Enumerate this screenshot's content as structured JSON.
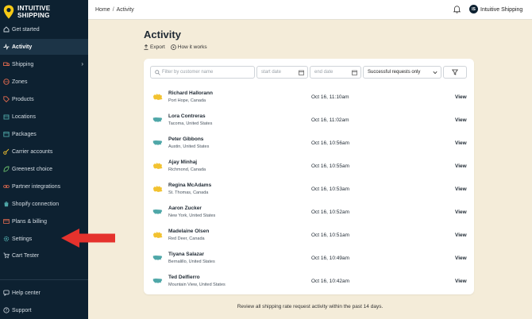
{
  "brand": {
    "line1": "INTUITIVE",
    "line2": "SHIPPING",
    "accent": "#f6c915"
  },
  "sidebar": {
    "items": [
      {
        "label": "Get started",
        "icon": "home-icon"
      },
      {
        "label": "Activity",
        "icon": "activity-icon",
        "active": true
      },
      {
        "label": "Shipping",
        "icon": "truck-icon",
        "expandable": true
      },
      {
        "label": "Zones",
        "icon": "globe-icon"
      },
      {
        "label": "Products",
        "icon": "tag-icon"
      },
      {
        "label": "Locations",
        "icon": "pin-icon"
      },
      {
        "label": "Packages",
        "icon": "package-icon"
      },
      {
        "label": "Carrier accounts",
        "icon": "key-icon"
      },
      {
        "label": "Greenest choice",
        "icon": "leaf-icon"
      },
      {
        "label": "Partner integrations",
        "icon": "link-icon"
      },
      {
        "label": "Shopify connection",
        "icon": "shopify-icon"
      },
      {
        "label": "Plans & billing",
        "icon": "card-icon"
      },
      {
        "label": "Settings",
        "icon": "gear-icon"
      },
      {
        "label": "Cart Tester",
        "icon": "cart-icon"
      }
    ],
    "bottom": [
      {
        "label": "Help center",
        "icon": "help-icon"
      },
      {
        "label": "Support",
        "icon": "support-icon"
      }
    ]
  },
  "topbar": {
    "breadcrumb": [
      "Home",
      "Activity"
    ],
    "breadcrumb_separator": "/",
    "avatar_initials": "IS",
    "account_name": "Intuitive Shipping"
  },
  "main": {
    "title": "Activity",
    "export_label": "Export",
    "how_label": "How it works"
  },
  "filters": {
    "search_placeholder": "Filter by customer name",
    "start_placeholder": "start date",
    "end_placeholder": "end date",
    "status_value": "Successful requests only"
  },
  "rows": [
    {
      "name": "Richard Hallorann",
      "location": "Port Hope, Canada",
      "time": "Oct 16, 11:10am",
      "flag": "canada",
      "action": "View"
    },
    {
      "name": "Lora Contreras",
      "location": "Tacoma, United States",
      "time": "Oct 16, 11:02am",
      "flag": "usa",
      "action": "View"
    },
    {
      "name": "Peter Gibbons",
      "location": "Austin, United States",
      "time": "Oct 16, 10:56am",
      "flag": "usa",
      "action": "View"
    },
    {
      "name": "Ajay Minhaj",
      "location": "Richmond, Canada",
      "time": "Oct 16, 10:55am",
      "flag": "canada",
      "action": "View"
    },
    {
      "name": "Regina McAdams",
      "location": "St. Thomas, Canada",
      "time": "Oct 16, 10:53am",
      "flag": "canada",
      "action": "View"
    },
    {
      "name": "Aaron Zucker",
      "location": "New York, United States",
      "time": "Oct 16, 10:52am",
      "flag": "usa",
      "action": "View"
    },
    {
      "name": "Madelaine Olsen",
      "location": "Red Deer, Canada",
      "time": "Oct 16, 10:51am",
      "flag": "canada",
      "action": "View"
    },
    {
      "name": "Tiyana Salazar",
      "location": "Bernalillo, United States",
      "time": "Oct 16, 10:49am",
      "flag": "usa",
      "action": "View"
    },
    {
      "name": "Ted Delfierro",
      "location": "Mountain View, United States",
      "time": "Oct 16, 10:42am",
      "flag": "usa",
      "action": "View"
    }
  ],
  "footnote": "Review all shipping rate request activity within the past 14 days.",
  "colors": {
    "sidebar_bg": "#0d2131",
    "page_bg": "#f4ecd9",
    "canada_map": "#f2c230",
    "usa_map": "#4fa7a8",
    "arrow": "#e5322d"
  }
}
